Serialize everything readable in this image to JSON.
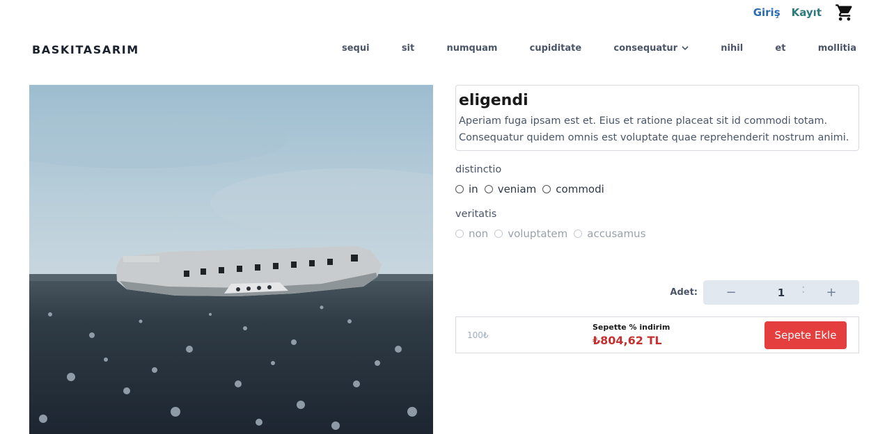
{
  "header": {
    "login_label": "Giriş",
    "register_label": "Kayıt",
    "cart_icon": "cart-icon",
    "brand": "BASKITASARIM"
  },
  "nav": {
    "items": [
      "sequi",
      "sit",
      "numquam",
      "cupiditate",
      "consequatur",
      "nihil",
      "et",
      "mollitia"
    ]
  },
  "product": {
    "title": "eligendi",
    "description": "Aperiam fuga ipsam est et. Eius et ratione placeat sit id commodi totam. Consequatur quidem omnis est voluptate quae reprehenderit nostrum animi.",
    "option_groups": [
      {
        "label": "distinctio",
        "options": [
          "in",
          "veniam",
          "commodi"
        ],
        "disabled": false
      },
      {
        "label": "veritatis",
        "options": [
          "non",
          "voluptatem",
          "accusamus"
        ],
        "disabled": true
      }
    ],
    "quantity_label": "Adet:",
    "quantity": "1",
    "old_price": "100₺",
    "discount_label": "Sepette % indirim",
    "price": "₺804,62 TL",
    "add_to_cart_label": "Sepete Ekle"
  },
  "colors": {
    "accent_red": "#e53e3e",
    "price_red": "#c53030",
    "link_teal": "#2c7a7b"
  }
}
